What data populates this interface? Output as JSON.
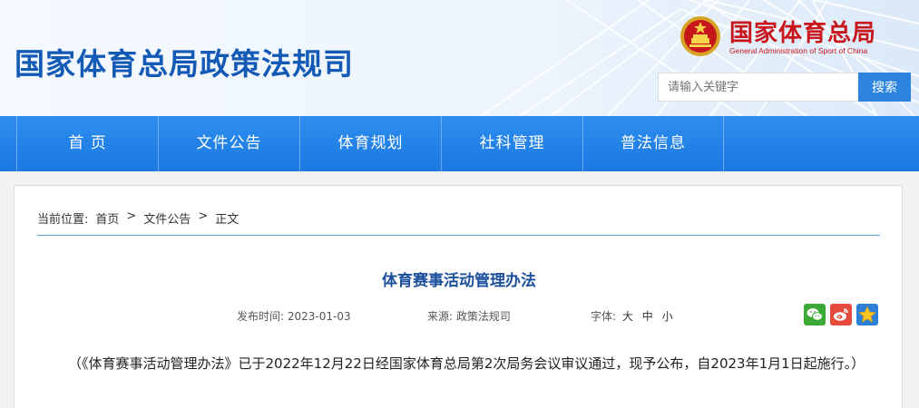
{
  "header": {
    "site_title": "国家体育总局政策法规司",
    "brand_cn": "国家体育总局",
    "brand_en": "General Administration of Sport of China",
    "search_placeholder": "请输入关键字",
    "search_button": "搜索"
  },
  "nav": {
    "items": [
      {
        "label": "首 页"
      },
      {
        "label": "文件公告"
      },
      {
        "label": "体育规划"
      },
      {
        "label": "社科管理"
      },
      {
        "label": "普法信息"
      }
    ]
  },
  "breadcrumb": {
    "prefix": "当前位置:",
    "items": [
      "首页",
      "文件公告",
      "正文"
    ],
    "separator": ">"
  },
  "article": {
    "title": "体育赛事活动管理办法",
    "publish_label": "发布时间:",
    "publish_date": "2023-01-03",
    "source_label": "来源:",
    "source": "政策法规司",
    "font_label": "字体:",
    "font_large": "大",
    "font_medium": "中",
    "font_small": "小",
    "body": "（《体育赛事活动管理办法》已于2022年12月22日经国家体育总局第2次局务会议审议通过，现予公布，自2023年1月1日起施行。）"
  },
  "share": {
    "icons": [
      "wechat-icon",
      "weibo-icon",
      "favorite-star-icon"
    ]
  },
  "colors": {
    "nav_blue": "#1a78e0",
    "title_blue": "#1359b6",
    "brand_red": "#c8161d",
    "wechat_green": "#3aa935",
    "weibo_red": "#e44b3c",
    "star_blue": "#2b7fd6"
  }
}
